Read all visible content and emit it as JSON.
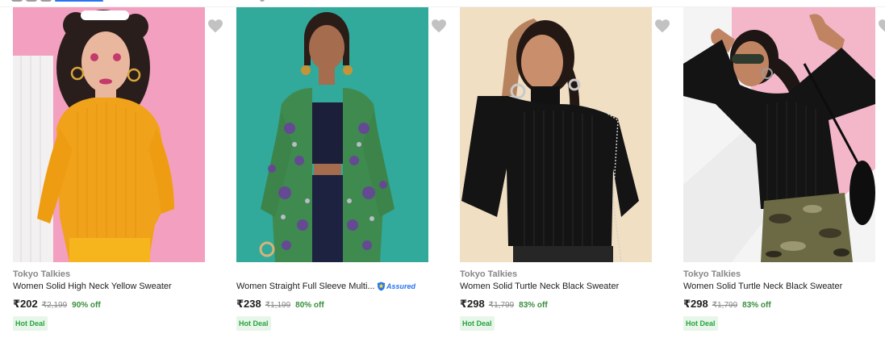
{
  "products": [
    {
      "brand": "Tokyo Talkies",
      "title": "Women Solid High Neck Yellow Sweater",
      "price": "₹202",
      "mrp": "₹2,199",
      "discount": "90% off",
      "badge": "Hot Deal",
      "assured": false,
      "image": "woman-yellow-sweater-pink-backdrop",
      "wishlist_icon": "heart-icon",
      "wishlist_color": "#c2c2c2"
    },
    {
      "brand": "",
      "title": "Women Straight Full Sleeve Multi...",
      "price": "₹238",
      "mrp": "₹1,199",
      "discount": "80% off",
      "badge": "Hot Deal",
      "assured": true,
      "assured_label": "Assured",
      "image": "woman-floral-jacket-teal-backdrop",
      "wishlist_icon": "heart-icon",
      "wishlist_color": "#c2c2c2"
    },
    {
      "brand": "Tokyo Talkies",
      "title": "Women Solid Turtle Neck Black Sweater",
      "price": "₹298",
      "mrp": "₹1,799",
      "discount": "83% off",
      "badge": "Hot Deal",
      "assured": false,
      "image": "woman-black-turtleneck-beige-backdrop",
      "wishlist_icon": "heart-icon",
      "wishlist_color": "#c2c2c2"
    },
    {
      "brand": "Tokyo Talkies",
      "title": "Women Solid Turtle Neck Black Sweater",
      "price": "₹298",
      "mrp": "₹1,799",
      "discount": "83% off",
      "badge": "Hot Deal",
      "assured": false,
      "image": "woman-black-turtleneck-camo-pants",
      "wishlist_icon": "heart-icon",
      "wishlist_color": "#c2c2c2"
    }
  ],
  "colors": {
    "discount_green": "#388e3c",
    "deal_badge_bg": "#e8f5e9",
    "deal_badge_text": "#26a541",
    "assured_blue": "#2874f0",
    "brand_grey": "#878787"
  }
}
